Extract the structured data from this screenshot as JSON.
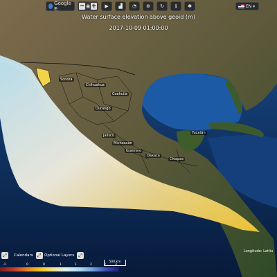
{
  "toolbar": {
    "layer_label": "Google E:",
    "zoom_out": "−",
    "zoom_in": "+",
    "icons": [
      "play-icon",
      "bar-chart-icon",
      "speedometer-icon",
      "globe-settings-icon",
      "refresh-icon",
      "info-icon",
      "settings-icon"
    ]
  },
  "language": {
    "label": "EN"
  },
  "overlay": {
    "title": "Water surface elevation above geoid (m)",
    "datetime": "2017-10-09 01:00:00"
  },
  "map_labels": {
    "sonora": "Sonora",
    "chihuahua": "Chihuahua",
    "coahuila": "Coahuila",
    "durango": "Durango",
    "jalisco": "Jalisco",
    "michoacan": "Michoacán",
    "guerrero": "Guerrero",
    "oaxaca": "Oaxaca",
    "chiapas": "Chiapas",
    "yucatan": "Yucatán"
  },
  "bottom": {
    "calendar_label": "Calendars",
    "optional_layers_label": "Optional Layers",
    "scale_label": "500 km",
    "coordinates_label": "Longitude: Latitu"
  },
  "colorbar": {
    "ticks": [
      "-1",
      "0",
      "0",
      "1",
      "1",
      "2",
      "2",
      "3"
    ],
    "colors": [
      "#7a1d1d",
      "#c0392b",
      "#e67e22",
      "#f1c40f",
      "#f5e08c",
      "#dff0f5",
      "#aedcef",
      "#6ea3d9",
      "#3b4fb0",
      "#201a7a"
    ]
  }
}
